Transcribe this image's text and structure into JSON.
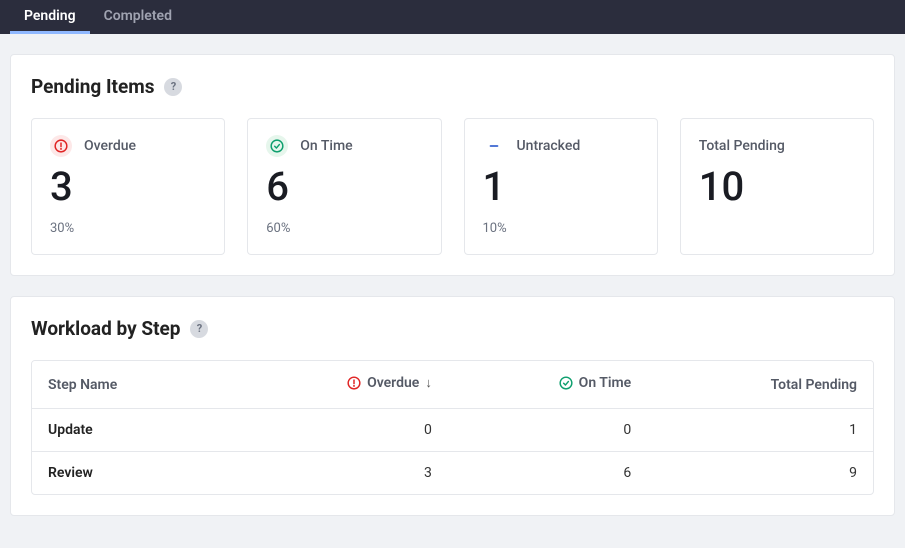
{
  "tabs": {
    "pending": "Pending",
    "completed": "Completed"
  },
  "pendingItems": {
    "title": "Pending Items",
    "cards": {
      "overdue": {
        "label": "Overdue",
        "value": "3",
        "pct": "30%"
      },
      "ontime": {
        "label": "On Time",
        "value": "6",
        "pct": "60%"
      },
      "untracked": {
        "label": "Untracked",
        "value": "1",
        "pct": "10%"
      },
      "total": {
        "label": "Total Pending",
        "value": "10"
      }
    }
  },
  "workload": {
    "title": "Workload by Step",
    "columns": {
      "stepName": "Step Name",
      "overdue": "Overdue",
      "ontime": "On Time",
      "total": "Total Pending"
    },
    "rows": [
      {
        "step": "Update",
        "overdue": "0",
        "ontime": "0",
        "total": "1"
      },
      {
        "step": "Review",
        "overdue": "3",
        "ontime": "6",
        "total": "9"
      }
    ]
  }
}
